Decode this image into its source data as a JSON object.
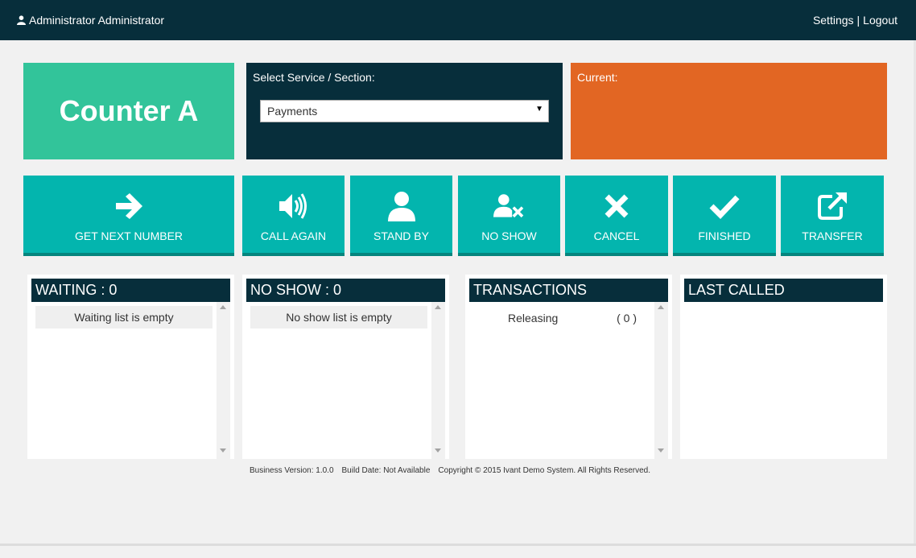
{
  "header": {
    "user_icon": "user-icon",
    "user_name": "Administrator Administrator",
    "settings_label": "Settings",
    "separator": "|",
    "logout_label": "Logout"
  },
  "counter": {
    "title": "Counter A"
  },
  "service": {
    "label": "Select Service / Section:",
    "selected": "Payments"
  },
  "current": {
    "label": "Current:"
  },
  "actions": [
    {
      "label": "GET NEXT NUMBER",
      "icon": "arrow-right-icon"
    },
    {
      "label": "CALL AGAIN",
      "icon": "speaker-icon"
    },
    {
      "label": "STAND BY",
      "icon": "user-icon"
    },
    {
      "label": "NO SHOW",
      "icon": "user-remove-icon"
    },
    {
      "label": "CANCEL",
      "icon": "close-icon"
    },
    {
      "label": "FINISHED",
      "icon": "check-icon"
    },
    {
      "label": "TRANSFER",
      "icon": "external-link-icon"
    }
  ],
  "panels": {
    "waiting": {
      "title": "WAITING : 0",
      "empty": "Waiting list is empty"
    },
    "noshow": {
      "title": "NO SHOW : 0",
      "empty": "No show list is empty"
    },
    "transactions": {
      "title": "TRANSACTIONS",
      "rows": [
        {
          "name": "Releasing",
          "count": "( 0 )"
        }
      ]
    },
    "last_called": {
      "title": "LAST CALLED"
    }
  },
  "footer": {
    "version": "Business Version: 1.0.0",
    "build": "Build Date: Not Available",
    "copyright": "Copyright © 2015 Ivant Demo System. All Rights Reserved."
  },
  "colors": {
    "navy": "#072e3b",
    "green": "#32c49a",
    "orange": "#e26623",
    "teal": "#03b5ae"
  }
}
